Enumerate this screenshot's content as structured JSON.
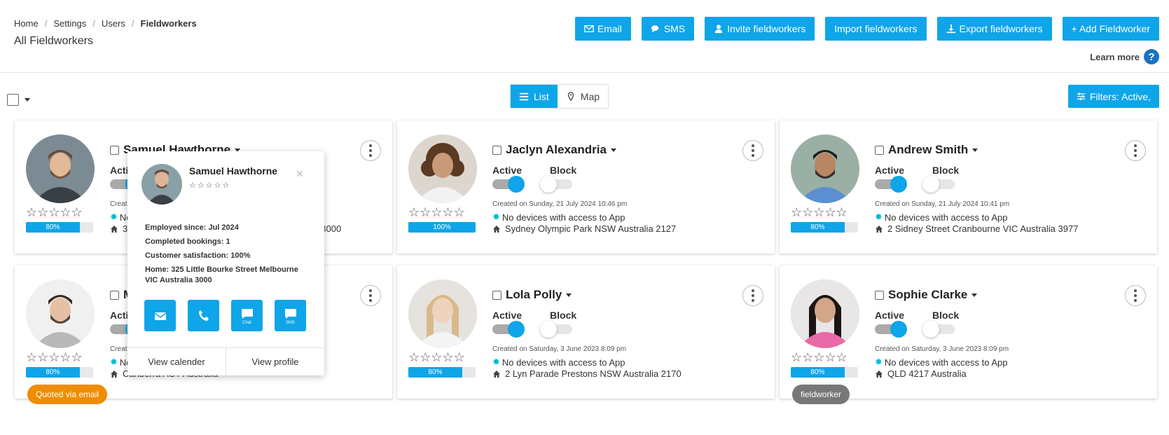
{
  "breadcrumb": [
    "Home",
    "Settings",
    "Users",
    "Fieldworkers"
  ],
  "page_title": "All Fieldworkers",
  "buttons": {
    "email": "Email",
    "sms": "SMS",
    "invite": "Invite fieldworkers",
    "import": "Import fieldworkers",
    "export": "Export fieldworkers",
    "add": "+ Add Fieldworker"
  },
  "learn_more": "Learn more",
  "view_toggle": {
    "list": "List",
    "map": "Map",
    "selected": "List"
  },
  "filters_label": "Filters: Active,",
  "labels": {
    "active": "Active",
    "block": "Block"
  },
  "accent_color": "#0ea5e9",
  "cards": [
    {
      "name": "Samuel Hawthorne",
      "progress": "80%",
      "created": "Created on Sunday, 21 July 2024 10:46 pm",
      "devices": "No devices with access to App",
      "address": "325 Little Bourke Street Melbourne VIC Australia 3000",
      "tag": ""
    },
    {
      "name": "Jaclyn Alexandria",
      "progress": "100%",
      "created": "Created on Sunday, 21 July 2024 10:46 pm",
      "devices": "No devices with access to App",
      "address": "Sydney Olympic Park NSW Australia 2127",
      "tag": ""
    },
    {
      "name": "Andrew Smith",
      "progress": "80%",
      "created": "Created on Sunday, 21 July 2024 10:41 pm",
      "devices": "No devices with access to App",
      "address": "2 Sidney Street Cranbourne VIC Australia 3977",
      "tag": ""
    },
    {
      "name": "M",
      "progress": "80%",
      "created": "Created",
      "devices": "No devices with access to App",
      "address": "Canberra ACT Australia",
      "tag": "Quoted via email",
      "tag_color": "#f08c00"
    },
    {
      "name": "Lola Polly",
      "progress": "80%",
      "created": "Created on Saturday, 3 June 2023 8:09 pm",
      "devices": "No devices with access to App",
      "address": "2 Lyn Parade Prestons NSW Australia 2170",
      "tag": ""
    },
    {
      "name": "Sophie Clarke",
      "progress": "80%",
      "created": "Created on Saturday, 3 June 2023 8:09 pm",
      "devices": "No devices with access to App",
      "address": "QLD 4217 Australia",
      "tag": "fieldworker",
      "tag_color": "#777777"
    }
  ],
  "popup": {
    "name": "Samuel Hawthorne",
    "employed": "Employed since: Jul 2024",
    "bookings": "Completed bookings: 1",
    "satisfaction": "Customer satisfaction: 100%",
    "home": "Home: 325 Little Bourke Street Melbourne VIC Australia 3000",
    "chat_label": "Chat",
    "sms_label": "SMS",
    "view_calendar": "View calender",
    "view_profile": "View profile"
  }
}
